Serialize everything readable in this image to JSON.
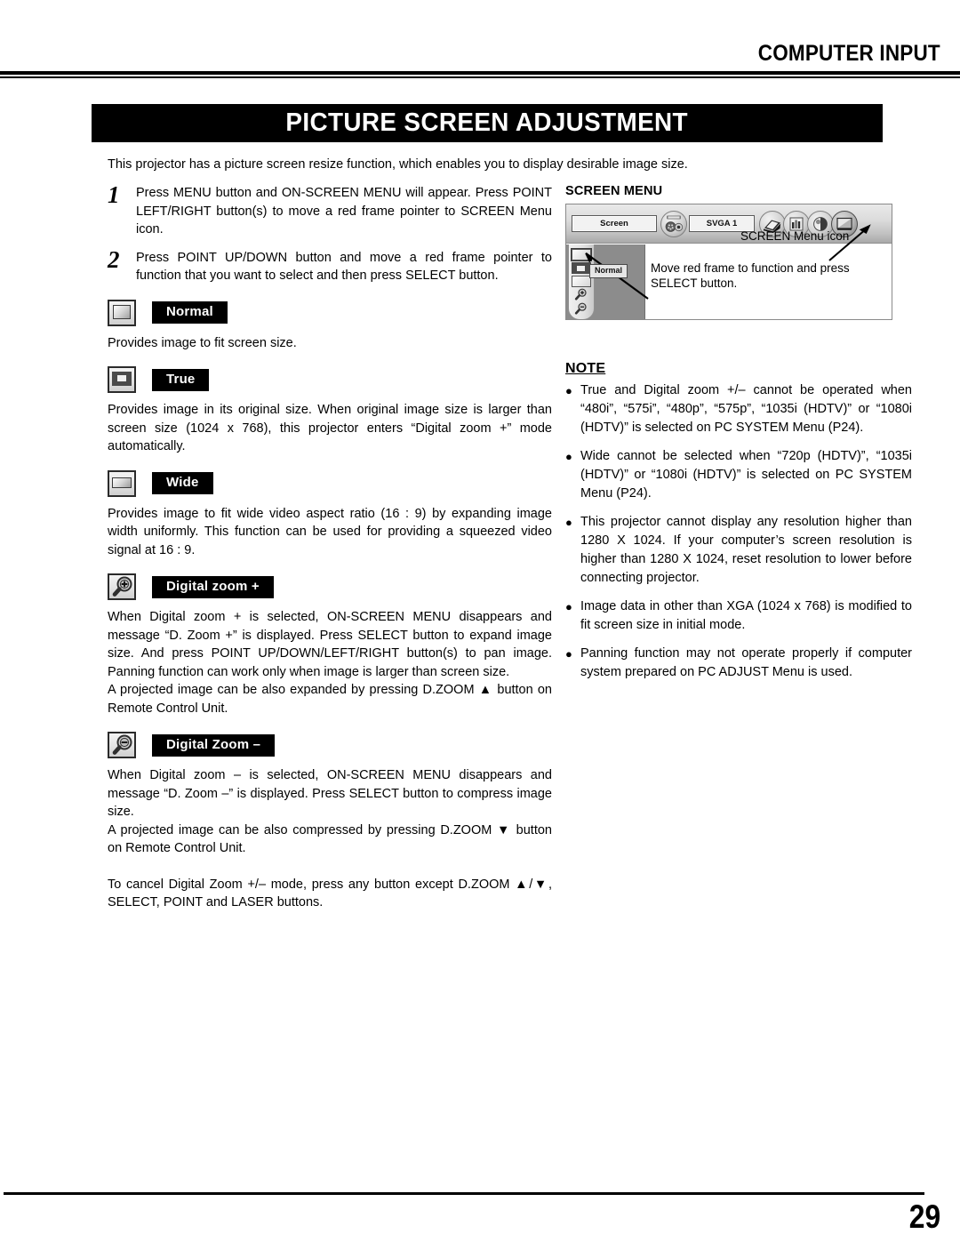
{
  "header": {
    "title": "COMPUTER INPUT"
  },
  "banner": {
    "title": "PICTURE SCREEN ADJUSTMENT"
  },
  "intro": "This projector has a picture screen resize function, which enables you to display desirable image size.",
  "steps": [
    {
      "number": "1",
      "text": "Press MENU button and ON-SCREEN MENU will appear.  Press POINT LEFT/RIGHT button(s) to move a red frame pointer to SCREEN Menu icon."
    },
    {
      "number": "2",
      "text": "Press POINT UP/DOWN button and move a red frame pointer to function that you want to select and then press SELECT button."
    }
  ],
  "functions": [
    {
      "icon": "screen-normal-icon",
      "label": "Normal",
      "paragraphs": [
        "Provides image to fit screen size."
      ]
    },
    {
      "icon": "screen-true-icon",
      "label": "True",
      "paragraphs": [
        "Provides image in its original size.  When original image size is larger than screen size (1024 x 768), this projector enters “Digital zoom +” mode automatically."
      ]
    },
    {
      "icon": "screen-wide-icon",
      "label": "Wide",
      "paragraphs": [
        "Provides image to fit wide video aspect ratio (16 : 9) by expanding image width uniformly.  This function can be used for providing a squeezed video signal at 16 : 9."
      ]
    },
    {
      "icon": "magnifier-plus-icon",
      "label": "Digital zoom +",
      "paragraphs": [
        "When Digital zoom + is selected, ON-SCREEN MENU disappears and message “D. Zoom +” is displayed.  Press SELECT button to expand image size.  And press POINT UP/DOWN/LEFT/RIGHT button(s) to pan image.  Panning function can work only when image is larger than screen size.",
        "A projected image can be also expanded by pressing D.ZOOM ▲ button on Remote Control Unit."
      ]
    },
    {
      "icon": "magnifier-minus-icon",
      "label": "Digital Zoom –",
      "paragraphs": [
        "When Digital zoom – is selected, ON-SCREEN MENU disappears and message “D. Zoom –” is displayed.  Press SELECT button to compress image size.",
        "A projected image can be also compressed by pressing D.ZOOM ▼ button on Remote Control Unit."
      ]
    }
  ],
  "closing": "To cancel Digital Zoom +/– mode, press any button except D.ZOOM ▲/▼, SELECT, POINT and LASER buttons.",
  "screen_menu": {
    "title": "SCREEN MENU",
    "bar": {
      "field_label": "Screen",
      "system_label": "SVGA 1",
      "icons": [
        "input-connector-icon",
        "pc-adjust-icon",
        "image-level-icon",
        "image-adjust-icon",
        "screen-menu-icon"
      ]
    },
    "sidebar_items": [
      "screen-normal-icon",
      "screen-true-icon",
      "screen-wide-icon",
      "magnifier-plus-icon",
      "magnifier-minus-icon"
    ],
    "tooltip": "Normal",
    "callout_icon": "SCREEN Menu icon",
    "callout_move": "Move red frame to function and press SELECT button."
  },
  "note": {
    "title": "NOTE",
    "bullet": "●",
    "items": [
      "True and Digital zoom +/– cannot be operated when “480i”, “575i”, “480p”, “575p”, “1035i (HDTV)” or “1080i (HDTV)” is selected on PC SYSTEM Menu  (P24).",
      "Wide cannot be selected when “720p (HDTV)”, “1035i (HDTV)” or “1080i (HDTV)” is selected on PC SYSTEM Menu  (P24).",
      "This projector cannot display any resolution higher than 1280 X 1024.  If your computer’s screen resolution is higher than 1280 X 1024, reset resolution to lower before connecting projector.",
      "Image data in other than XGA (1024 x 768) is modified to fit screen size in initial mode.",
      "Panning function may not operate properly if computer system prepared on PC ADJUST Menu is used."
    ]
  },
  "footer": {
    "page_number": "29"
  },
  "colors": {
    "ink": "#000000",
    "paper": "#ffffff",
    "osd_body": "#8c8c8c"
  }
}
